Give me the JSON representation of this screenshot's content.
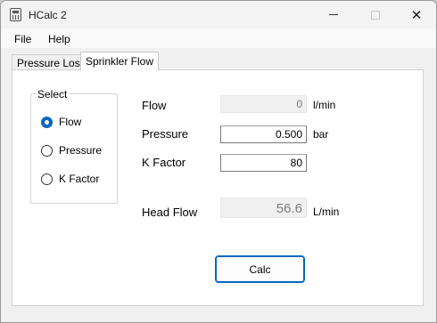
{
  "window": {
    "title": "HCalc 2",
    "close_glyph": "✕"
  },
  "menu": {
    "file": "File",
    "help": "Help"
  },
  "tabs": [
    {
      "label": "Pressure Loss",
      "active": false
    },
    {
      "label": "Sprinkler Flow",
      "active": true
    }
  ],
  "select_group": {
    "title": "Select",
    "options": [
      {
        "label": "Flow",
        "checked": true
      },
      {
        "label": "Pressure",
        "checked": false
      },
      {
        "label": "K Factor",
        "checked": false
      }
    ]
  },
  "fields": {
    "flow": {
      "label": "Flow",
      "value": "0",
      "unit": "l/min",
      "readonly": true
    },
    "pressure": {
      "label": "Pressure",
      "value": "0.500",
      "unit": "bar",
      "readonly": false
    },
    "k_factor": {
      "label": "K Factor",
      "value": "80",
      "unit": "",
      "readonly": false
    },
    "head_flow": {
      "label": "Head Flow",
      "value": "56.6",
      "unit": "L/min",
      "readonly": true
    }
  },
  "buttons": {
    "calc": "Calc"
  },
  "colors": {
    "accent": "#0067c0",
    "window_bg": "#f0f0f0",
    "panel_bg": "#ffffff"
  },
  "icons": {
    "app": "calculator-icon",
    "minimize": "minimize-icon",
    "maximize": "maximize-icon",
    "close": "close-icon"
  }
}
